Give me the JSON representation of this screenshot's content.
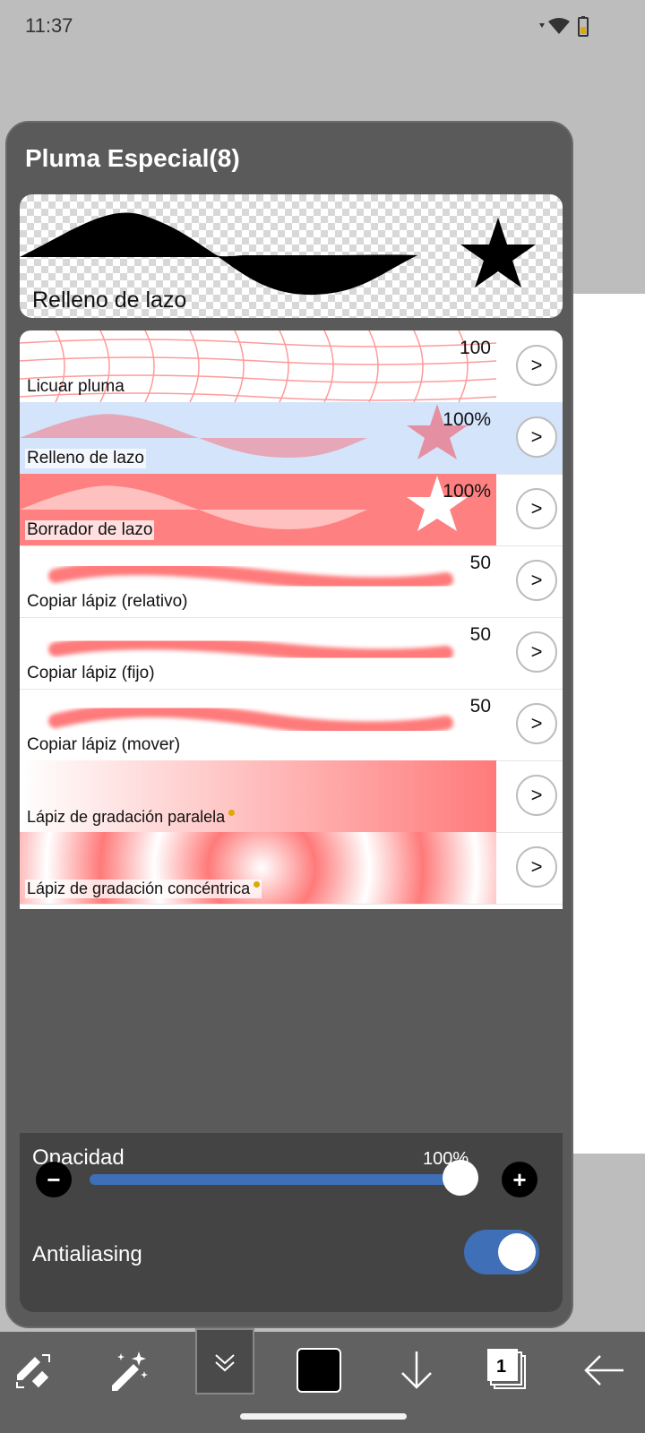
{
  "status": {
    "time": "11:37"
  },
  "panel": {
    "title": "Pluma Especial(8)",
    "preview_label": "Relleno de lazo"
  },
  "brushes": [
    {
      "name": "Licuar pluma",
      "value": "100"
    },
    {
      "name": "Relleno de lazo",
      "value": "100%"
    },
    {
      "name": "Borrador de lazo",
      "value": "100%"
    },
    {
      "name": "Copiar lápiz (relativo)",
      "value": "50"
    },
    {
      "name": "Copiar lápiz (fijo)",
      "value": "50"
    },
    {
      "name": "Copiar lápiz (mover)",
      "value": "50"
    },
    {
      "name": "Lápiz de gradación paralela",
      "value": ""
    },
    {
      "name": "Lápiz de gradación concéntrica",
      "value": ""
    }
  ],
  "arrow_label": ">",
  "settings": {
    "opacity_label": "Opacidad",
    "opacity_value": "100%",
    "opacity_level": 1.0,
    "antialiasing_label": "Antialiasing",
    "antialiasing_on": true
  },
  "toolbar": {
    "layer_count": "1"
  },
  "colors": {
    "accent": "#3f6fb6",
    "selected_row": "#d4e4fa",
    "brush_pink": "#ff8080"
  }
}
